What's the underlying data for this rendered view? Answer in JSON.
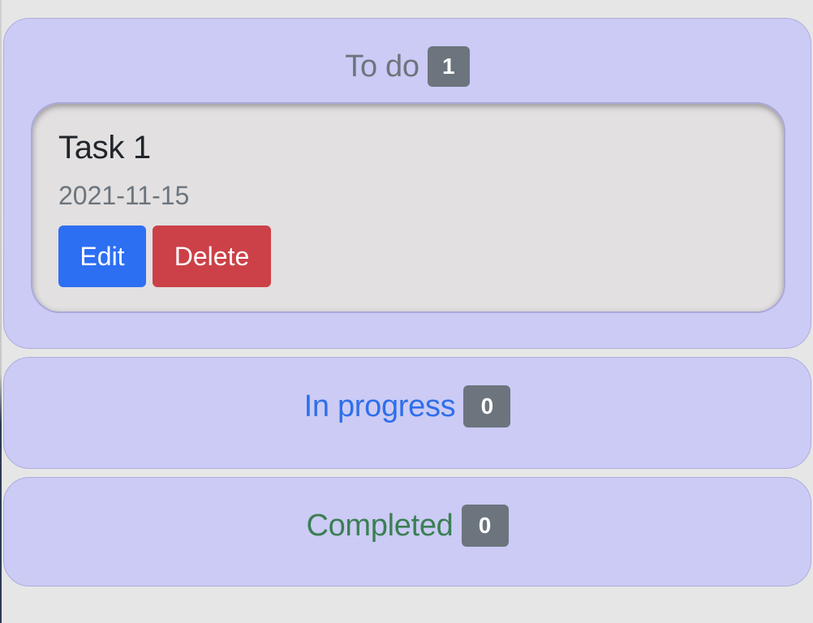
{
  "columns": {
    "todo": {
      "title": "To do",
      "count": "1",
      "tasks": [
        {
          "title": "Task 1",
          "date": "2021-11-15",
          "edit_label": "Edit",
          "delete_label": "Delete"
        }
      ]
    },
    "in_progress": {
      "title": "In progress",
      "count": "0"
    },
    "completed": {
      "title": "Completed",
      "count": "0"
    }
  },
  "colors": {
    "column_bg": "#cbcbf5",
    "card_bg": "#e3e0e1",
    "badge": "#6c757d",
    "todo_title": "#6c757d",
    "in_progress_title": "#2f6fe8",
    "completed_title": "#3b7f53",
    "edit_button": "#2d6ff2",
    "delete_button": "#cc4148"
  }
}
